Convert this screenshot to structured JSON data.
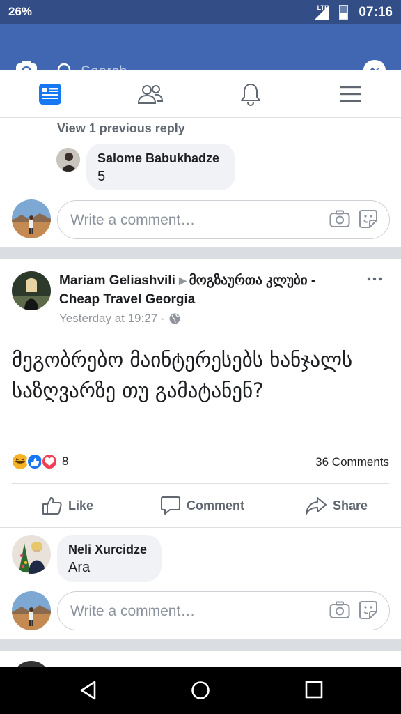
{
  "status": {
    "battery_percent": "26%",
    "network": "LTE",
    "time": "07:16"
  },
  "header": {
    "search_placeholder": "Search"
  },
  "nav": {
    "tabs": [
      "news-feed",
      "friends",
      "notifications",
      "menu"
    ]
  },
  "reply_thread": {
    "view_previous": "View 1 previous reply",
    "reply": {
      "name": "Salome Babukhadze",
      "text": "5"
    },
    "write_placeholder": "Write a comment…"
  },
  "post": {
    "author": "Mariam Geliashvili",
    "group": "მოგზაურთა კლუბი - Cheap Travel Georgia",
    "time": "Yesterday at 19:27 ·",
    "body": "მეგობრებო მაინტერესებს ხანჯალს საზღვარზე თუ გამატანენ?",
    "reactions_count": "8",
    "comments_count": "36 Comments",
    "actions": {
      "like": "Like",
      "comment": "Comment",
      "share": "Share"
    },
    "comment": {
      "name": "Neli Xurcidze",
      "text": "Ara"
    },
    "write_placeholder": "Write a comment…"
  },
  "colors": {
    "brand": "#4267b2",
    "status_bar": "#334d86",
    "like_blue": "#1877f2",
    "love_red": "#f33e58",
    "haha_yellow": "#f7b125"
  }
}
